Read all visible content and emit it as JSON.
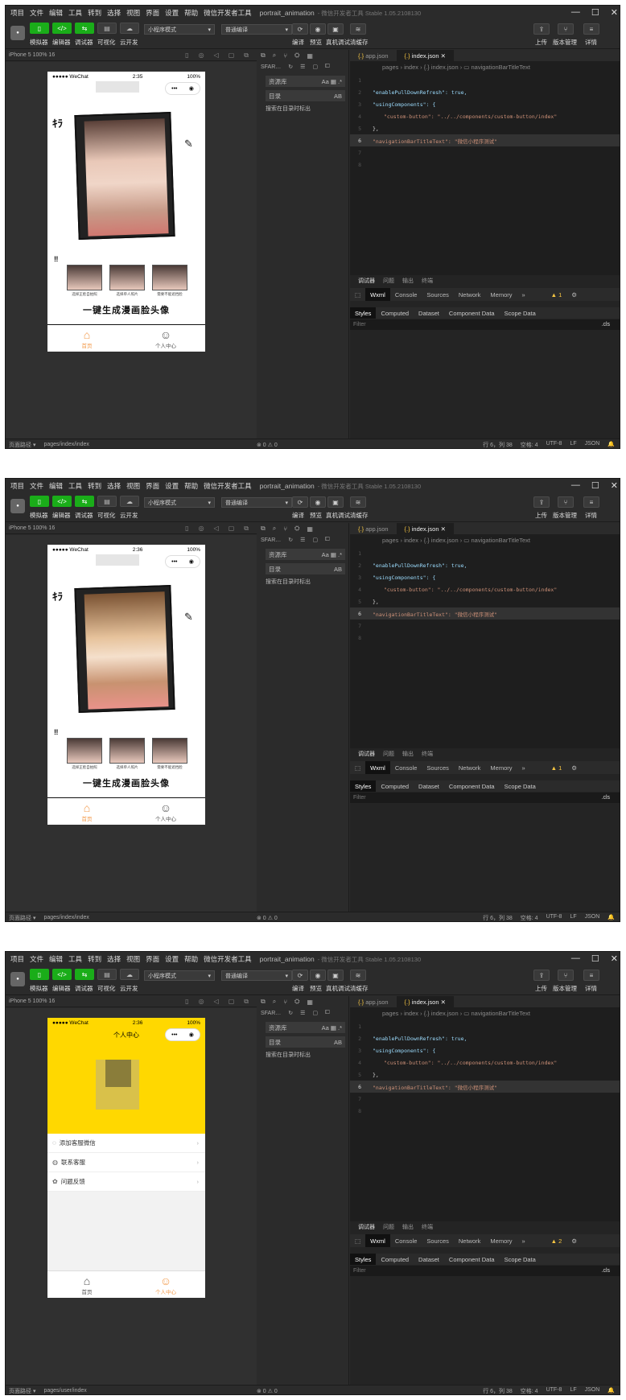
{
  "menu": [
    "项目",
    "文件",
    "编辑",
    "工具",
    "转到",
    "选择",
    "视图",
    "界面",
    "设置",
    "帮助",
    "微信开发者工具"
  ],
  "window_title": "portrait_animation",
  "window_sub": "- 微信开发者工具 Stable 1.05.2108130",
  "toolbar": {
    "labels": [
      "模拟器",
      "编辑器",
      "调试器",
      "可视化",
      "云开发"
    ],
    "mode": "小程序模式",
    "compile": "普通编译",
    "actions": [
      "编译",
      "预览",
      "真机调试",
      "清缓存"
    ],
    "right_actions": [
      "上传",
      "版本管理",
      "详情"
    ]
  },
  "sim": {
    "device": "iPhone 5 100% 16",
    "carrier": "●●●●● WeChat",
    "battery": "100%",
    "capsule_dots": "•••"
  },
  "screens": [
    {
      "time": "2:35",
      "tab1": "首页",
      "tab2": "个人中心",
      "slogan": "一键生成漫画脸头像",
      "captions": [
        "选择正脸自拍照",
        "选择单人照片",
        "需要不能遮挡脸"
      ]
    },
    {
      "time": "2:36",
      "tab1": "首页",
      "tab2": "个人中心",
      "slogan": "一键生成漫画脸头像",
      "captions": [
        "选择正脸自拍照",
        "选择单人照片",
        "需要不能遮挡脸"
      ]
    },
    {
      "time": "2:36",
      "navtitle": "个人中心",
      "tab1": "首页",
      "tab2": "个人中心",
      "items": [
        "添加客服微信",
        "联系客服",
        "问题反馈"
      ]
    }
  ],
  "explorer": {
    "search": "SFAR…",
    "box1": "资源库",
    "box2": "目录",
    "hint": "搜索在目录时标出"
  },
  "editor": {
    "tab1": "app.json",
    "tab2": "index.json",
    "crumbs": "pages › index › {.} index.json › ▭ navigationBarTitleText",
    "line1": "\"enablePullDownRefresh\": true,",
    "line2": "\"usingComponents\": {",
    "line3": "\"custom-button\": \"../../components/custom-button/index\"",
    "line4": "},",
    "line5": "\"navigationBarTitleText\": \"微信小程序测试\"",
    "ln": [
      "1",
      "2",
      "3",
      "4",
      "5",
      "6",
      "7",
      "8"
    ]
  },
  "devtools": {
    "t1": [
      "调试器",
      "问题",
      "输出",
      "终端"
    ],
    "t2": [
      "Wxml",
      "Console",
      "Sources",
      "Network",
      "Memory",
      "»"
    ],
    "warn1": "▲ 1",
    "warn3": "▲ 2",
    "t3": [
      "Styles",
      "Computed",
      "Dataset",
      "Component Data",
      "Scope Data"
    ],
    "filter": "Filter",
    "cls": ".cls"
  },
  "bottom": {
    "left": "页面路径 ▾",
    "path1": "pages/index/index",
    "path3": "pages/user/index",
    "err": "⊗ 0 ⚠ 0",
    "pos": "行 6，列 38",
    "space": "空格: 4",
    "enc": "UTF-8",
    "eol": "LF",
    "lang": "JSON"
  }
}
